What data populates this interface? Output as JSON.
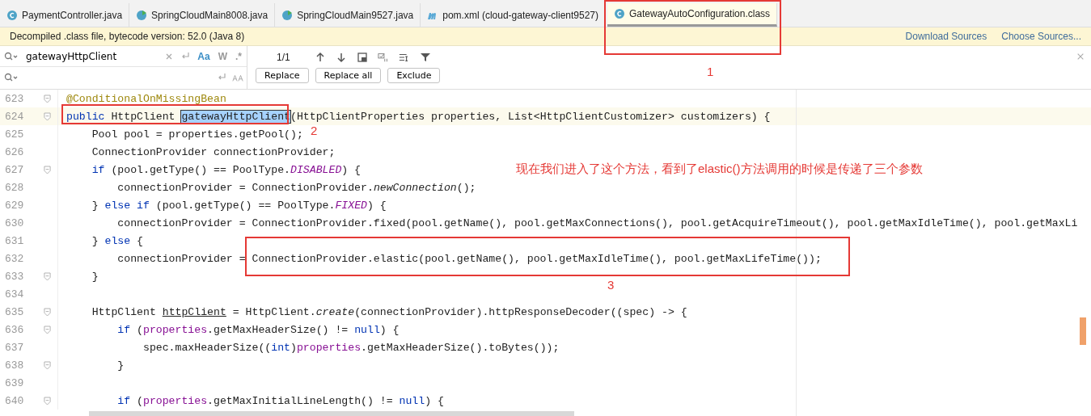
{
  "tabs": [
    {
      "label": "PaymentController.java",
      "kind": "class",
      "selected": false
    },
    {
      "label": "SpringCloudMain8008.java",
      "kind": "main",
      "selected": false
    },
    {
      "label": "SpringCloudMain9527.java",
      "kind": "main",
      "selected": false
    },
    {
      "label": "pom.xml (cloud-gateway-client9527)",
      "kind": "maven",
      "selected": false
    },
    {
      "label": "GatewayAutoConfiguration.class",
      "kind": "class",
      "selected": true
    }
  ],
  "banner": {
    "message": "Decompiled .class file, bytecode version: 52.0 (Java 8)",
    "links": [
      "Download Sources",
      "Choose Sources..."
    ]
  },
  "find": {
    "query": "gatewayHttpClient",
    "toggles": [
      {
        "label": "Aa",
        "selected": true
      },
      {
        "label": "W",
        "selected": false
      },
      {
        "label": ".*",
        "selected": false
      }
    ],
    "count": "1/1",
    "buttons": [
      "Replace",
      "Replace all",
      "Exclude"
    ]
  },
  "code": [
    {
      "number": "623",
      "current": false,
      "fold": true,
      "tokens": [
        {
          "kind": "ann",
          "text": "@ConditionalOnMissingBean"
        }
      ]
    },
    {
      "number": "624",
      "current": true,
      "fold": true,
      "tokens": [
        {
          "kind": "kw",
          "text": "public"
        },
        {
          "kind": "plain",
          "text": " HttpClient "
        },
        {
          "kind": "match",
          "text": "gatewayHttpClient"
        },
        {
          "kind": "plain",
          "text": "(HttpClientProperties properties, List<HttpClientCustomizer> customizers) {"
        }
      ]
    },
    {
      "number": "625",
      "current": false,
      "fold": false,
      "tokens": [
        {
          "kind": "plain",
          "text": "    Pool pool = properties.getPool();"
        }
      ]
    },
    {
      "number": "626",
      "current": false,
      "fold": false,
      "tokens": [
        {
          "kind": "plain",
          "text": "    ConnectionProvider connectionProvider;"
        }
      ]
    },
    {
      "number": "627",
      "current": false,
      "fold": true,
      "tokens": [
        {
          "kind": "kw",
          "text": "    if"
        },
        {
          "kind": "plain",
          "text": " (pool.getType() == PoolType."
        },
        {
          "kind": "const",
          "text": "DISABLED"
        },
        {
          "kind": "plain",
          "text": ") {"
        }
      ]
    },
    {
      "number": "628",
      "current": false,
      "fold": false,
      "tokens": [
        {
          "kind": "plain",
          "text": "        connectionProvider = ConnectionProvider."
        },
        {
          "kind": "italic",
          "text": "newConnection"
        },
        {
          "kind": "plain",
          "text": "();"
        }
      ]
    },
    {
      "number": "629",
      "current": false,
      "fold": false,
      "tokens": [
        {
          "kind": "plain",
          "text": "    } "
        },
        {
          "kind": "kw",
          "text": "else if"
        },
        {
          "kind": "plain",
          "text": " (pool.getType() == PoolType."
        },
        {
          "kind": "const",
          "text": "FIXED"
        },
        {
          "kind": "plain",
          "text": ") {"
        }
      ]
    },
    {
      "number": "630",
      "current": false,
      "fold": false,
      "tokens": [
        {
          "kind": "plain",
          "text": "        connectionProvider = ConnectionProvider.fixed(pool.getName(), pool.getMaxConnections(), pool.getAcquireTimeout(), pool.getMaxIdleTime(), pool.getMaxLi"
        }
      ]
    },
    {
      "number": "631",
      "current": false,
      "fold": false,
      "tokens": [
        {
          "kind": "plain",
          "text": "    } "
        },
        {
          "kind": "kw",
          "text": "else"
        },
        {
          "kind": "plain",
          "text": " {"
        }
      ]
    },
    {
      "number": "632",
      "current": false,
      "fold": false,
      "tokens": [
        {
          "kind": "plain",
          "text": "        connectionProvider = ConnectionProvider.elastic(pool.getName(), pool.getMaxIdleTime(), pool.getMaxLifeTime());"
        }
      ]
    },
    {
      "number": "633",
      "current": false,
      "fold": true,
      "tokens": [
        {
          "kind": "plain",
          "text": "    }"
        }
      ]
    },
    {
      "number": "634",
      "current": false,
      "fold": false
    },
    {
      "number": "635",
      "current": false,
      "fold": true,
      "tokens": [
        {
          "kind": "plain",
          "text": "    HttpClient "
        },
        {
          "kind": "ul",
          "text": "httpClient"
        },
        {
          "kind": "plain",
          "text": " = HttpClient."
        },
        {
          "kind": "italic",
          "text": "create"
        },
        {
          "kind": "plain",
          "text": "(connectionProvider).httpResponseDecoder((spec) -> {"
        }
      ]
    },
    {
      "number": "636",
      "current": false,
      "fold": true,
      "tokens": [
        {
          "kind": "kw",
          "text": "        if"
        },
        {
          "kind": "plain",
          "text": " ("
        },
        {
          "kind": "field",
          "text": "properties"
        },
        {
          "kind": "plain",
          "text": ".getMaxHeaderSize() != "
        },
        {
          "kind": "kw",
          "text": "null"
        },
        {
          "kind": "plain",
          "text": ") {"
        }
      ]
    },
    {
      "number": "637",
      "current": false,
      "fold": false,
      "tokens": [
        {
          "kind": "plain",
          "text": "            spec.maxHeaderSize(("
        },
        {
          "kind": "kw",
          "text": "int"
        },
        {
          "kind": "plain",
          "text": ")"
        },
        {
          "kind": "field",
          "text": "properties"
        },
        {
          "kind": "plain",
          "text": ".getMaxHeaderSize().toBytes());"
        }
      ]
    },
    {
      "number": "638",
      "current": false,
      "fold": true,
      "tokens": [
        {
          "kind": "plain",
          "text": "        }"
        }
      ]
    },
    {
      "number": "639",
      "current": false,
      "fold": false
    },
    {
      "number": "640",
      "current": false,
      "fold": true,
      "tokens": [
        {
          "kind": "kw",
          "text": "        if"
        },
        {
          "kind": "plain",
          "text": " ("
        },
        {
          "kind": "field",
          "text": "properties"
        },
        {
          "kind": "plain",
          "text": ".getMaxInitialLineLength() != "
        },
        {
          "kind": "kw",
          "text": "null"
        },
        {
          "kind": "plain",
          "text": ") {"
        }
      ]
    }
  ],
  "annotations": {
    "note": "现在我们进入了这个方法，看到了elastic()方法调用的时候是传递了三个参数",
    "markers": [
      "1",
      "2",
      "3"
    ]
  }
}
